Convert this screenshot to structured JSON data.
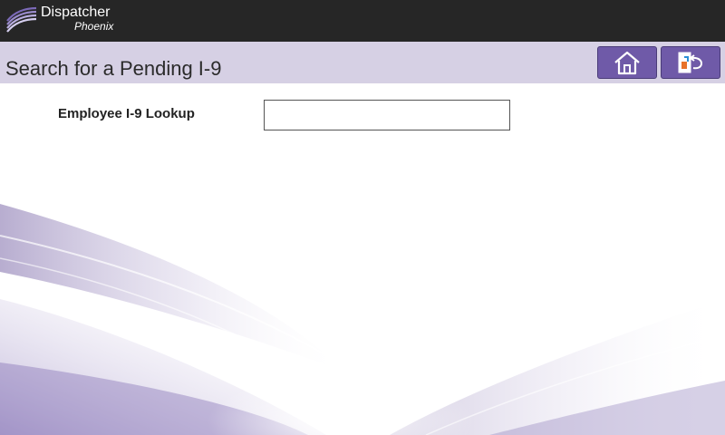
{
  "app": {
    "brand_name": "Dispatcher",
    "brand_sub": "Phoenix"
  },
  "page": {
    "title": "Search for a Pending I-9"
  },
  "nav": {
    "home_icon": "home-icon",
    "back_icon": "exit-back-icon"
  },
  "form": {
    "lookup_label": "Employee I-9 Lookup",
    "lookup_value": ""
  },
  "colors": {
    "topbar": "#262626",
    "titlebar": "#d6d0e4",
    "button": "#6f5aa8",
    "swoosh": "#8a78b8"
  }
}
